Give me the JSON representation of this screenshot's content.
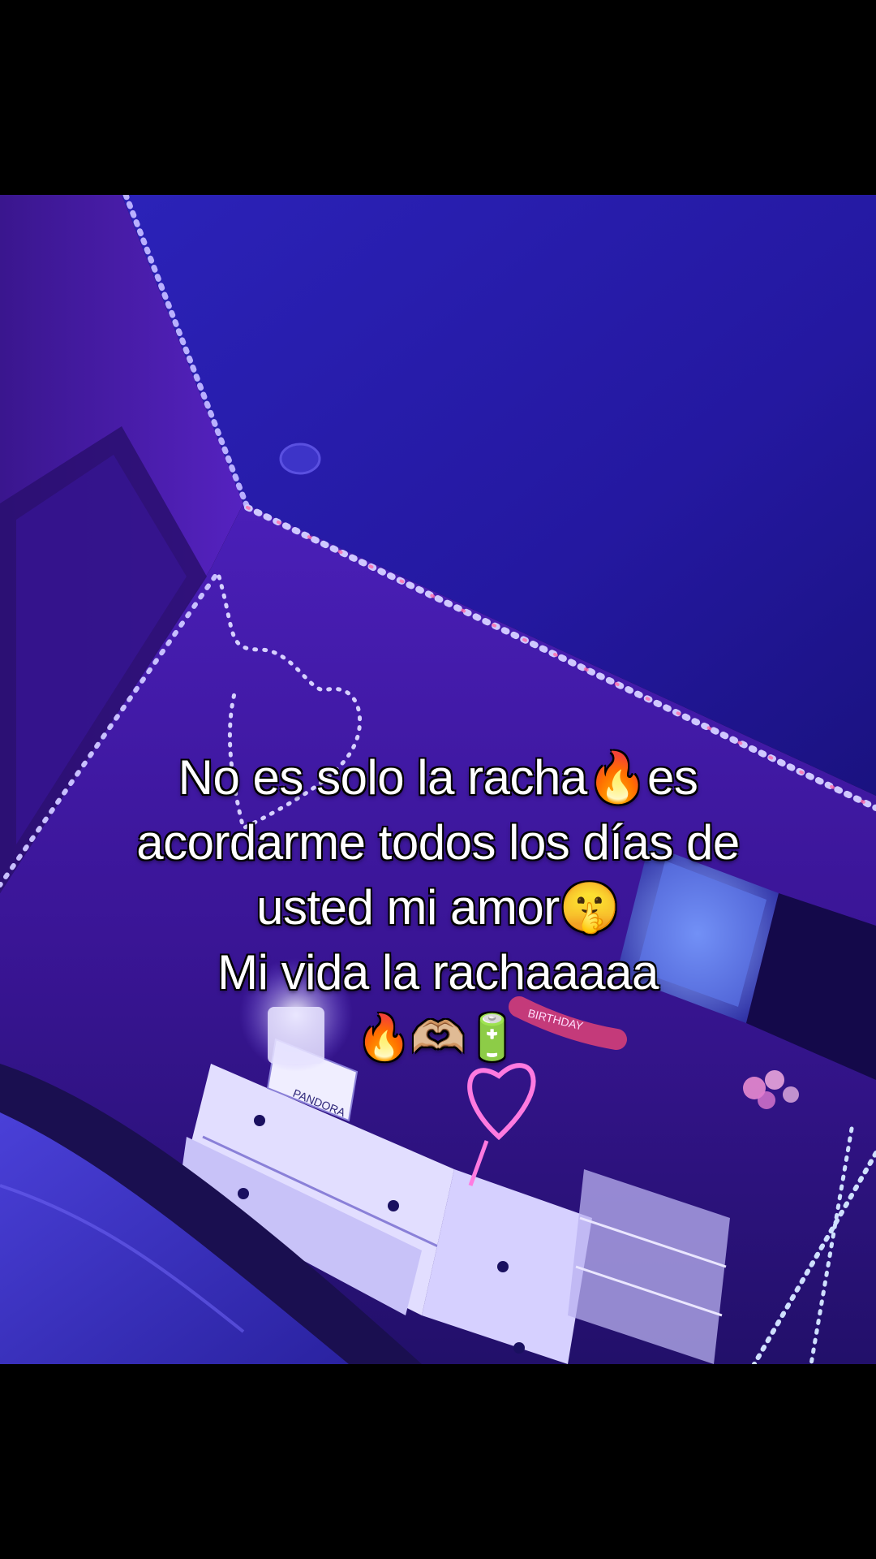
{
  "caption": {
    "line1": "No es solo la racha🔥es",
    "line2": "acordarme todos los días de",
    "line3": "usted mi amor🤫",
    "line4": "Mi vida la rachaaaaa",
    "line5": "🔥🫶🏼🔋"
  },
  "scene": {
    "dresser_brand": "PANDORA",
    "banner_text": "BIRTHDAY"
  },
  "colors": {
    "letterbox": "#000000",
    "ceiling": "#2a1fb0",
    "wall": "#3a1aa8",
    "led_light": "#d9d4ff",
    "neon_heart": "#ff5fd0"
  }
}
